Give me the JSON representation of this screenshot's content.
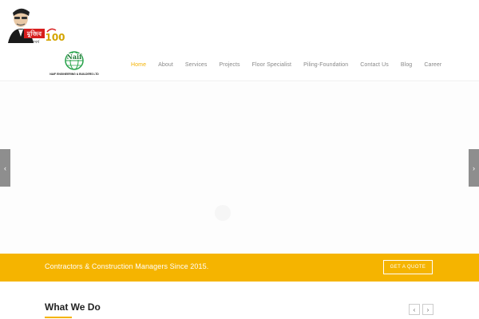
{
  "badge": {
    "bengali_text": "মুজিব",
    "bengali_sub": "শতবর্ষ",
    "number": "100"
  },
  "logo": {
    "mark_text": "Naif",
    "company_name": "NAIF ENGINEERING & BUILDERS LTD"
  },
  "nav": {
    "items": [
      {
        "label": "Home"
      },
      {
        "label": "About"
      },
      {
        "label": "Services"
      },
      {
        "label": "Projects"
      },
      {
        "label": "Floor Specialist"
      },
      {
        "label": "Piling-Foundation"
      },
      {
        "label": "Contact Us"
      },
      {
        "label": "Blog"
      },
      {
        "label": "Career"
      }
    ],
    "active_index": 0,
    "active_color": "#f3b200"
  },
  "slider": {
    "prev_icon": "chevron-left-icon",
    "next_icon": "chevron-right-icon",
    "prev_glyph": "‹",
    "next_glyph": "›"
  },
  "strip": {
    "text": "Contractors & Construction Managers Since 2015.",
    "button_label": "GET A QUOTE",
    "background": "#f5b400"
  },
  "what_we_do": {
    "title": "What We Do",
    "prev_glyph": "‹",
    "next_glyph": "›"
  }
}
